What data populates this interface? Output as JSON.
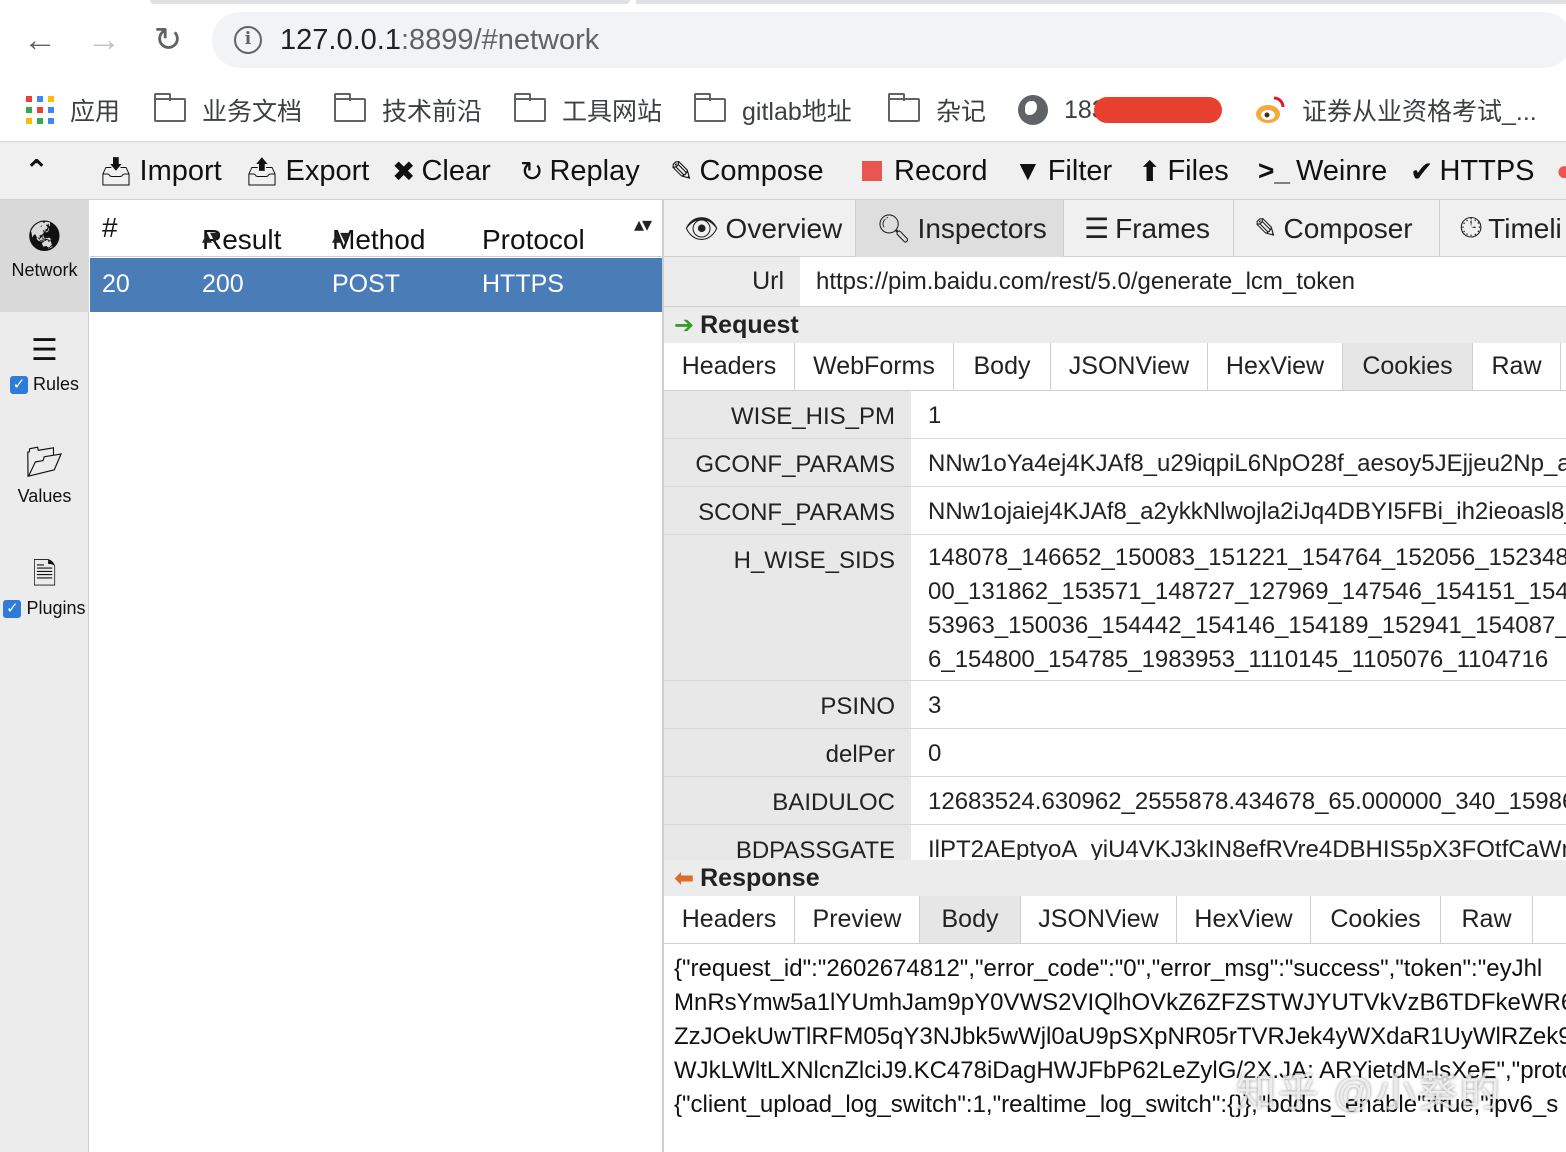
{
  "browser": {
    "nav": {
      "back": "←",
      "forward": "→",
      "reload": "↻"
    },
    "url_host": "127.0.0.1",
    "url_rest": ":8899/#network",
    "bookmarks": [
      {
        "label": "应用",
        "icon": "apps-icon"
      },
      {
        "label": "业务文档",
        "icon": "folder-icon"
      },
      {
        "label": "技术前沿",
        "icon": "folder-icon"
      },
      {
        "label": "工具网站",
        "icon": "folder-icon"
      },
      {
        "label": "gitlab地址",
        "icon": "folder-icon"
      },
      {
        "label": "杂记",
        "icon": "folder-icon"
      },
      {
        "label": "183",
        "icon": "globe-icon"
      },
      {
        "label": "证券从业资格考试_...",
        "icon": "weibo-icon"
      }
    ]
  },
  "toolbar": {
    "items": [
      {
        "label": "Import",
        "icon": "import-icon"
      },
      {
        "label": "Export",
        "icon": "export-icon"
      },
      {
        "label": "Clear",
        "icon": "clear-icon"
      },
      {
        "label": "Replay",
        "icon": "replay-icon"
      },
      {
        "label": "Compose",
        "icon": "compose-icon"
      },
      {
        "label": "Record",
        "icon": "record-icon"
      },
      {
        "label": "Filter",
        "icon": "filter-icon"
      },
      {
        "label": "Files",
        "icon": "files-icon"
      },
      {
        "label": "Weinre",
        "icon": "weinre-icon"
      },
      {
        "label": "HTTPS",
        "icon": "check-icon"
      }
    ]
  },
  "sidebar": {
    "items": [
      {
        "label": "Network",
        "icon": "globe-icon",
        "checked": null
      },
      {
        "label": "Rules",
        "icon": "list-icon",
        "checked": true
      },
      {
        "label": "Values",
        "icon": "folder-open-icon",
        "checked": null
      },
      {
        "label": "Plugins",
        "icon": "plugins-icon",
        "checked": true
      }
    ]
  },
  "sessions": {
    "columns": [
      "#",
      "Result",
      "Method",
      "Protocol"
    ],
    "rows": [
      {
        "id": "20",
        "result": "200",
        "method": "POST",
        "protocol": "HTTPS"
      }
    ]
  },
  "inspector": {
    "tabs": [
      {
        "label": "Overview",
        "icon": "eye-icon"
      },
      {
        "label": "Inspectors",
        "icon": "search-icon"
      },
      {
        "label": "Frames",
        "icon": "menu-icon"
      },
      {
        "label": "Composer",
        "icon": "compose-icon"
      },
      {
        "label": "Timeli",
        "icon": "clock-icon"
      }
    ],
    "active_tab": "Inspectors",
    "url_label": "Url",
    "url_value": "https://pim.baidu.com/rest/5.0/generate_lcm_token",
    "request": {
      "title": "Request",
      "tabs": [
        "Headers",
        "WebForms",
        "Body",
        "JSONView",
        "HexView",
        "Cookies",
        "Raw"
      ],
      "active_tab": "Cookies",
      "cookies": [
        {
          "name": "WISE_HIS_PM",
          "value": "1"
        },
        {
          "name": "GCONF_PARAMS",
          "value": "NNw1oYa4ej4KJAf8_u29iqpiL6NpO28f_aesoy5JEjjeu2Np_a"
        },
        {
          "name": "SCONF_PARAMS",
          "value": "NNw1ojaiej4KJAf8_a2ykkNlwojla2iJq4DBYI5FBi_ih2ieoasl8_"
        },
        {
          "name": "H_WISE_SIDS",
          "value": "148078_146652_150083_151221_154764_152056_152348_\n00_131862_153571_148727_127969_147546_154151_1542\n53963_150036_154442_154146_154189_152941_154087_1\n6_154800_154785_1983953_1110145_1105076_1104716"
        },
        {
          "name": "PSINO",
          "value": "3"
        },
        {
          "name": "delPer",
          "value": "0"
        },
        {
          "name": "BAIDULOC",
          "value": "12683524.630962_2555878.434678_65.000000_340_15986"
        },
        {
          "name": "BDPASSGATE",
          "value": "IlPT2AEptyoA_yiU4VKJ3kIN8efRVre4DBHIS5pX3FOtfCaWm"
        }
      ]
    },
    "response": {
      "title": "Response",
      "tabs": [
        "Headers",
        "Preview",
        "Body",
        "JSONView",
        "HexView",
        "Cookies",
        "Raw"
      ],
      "active_tab": "Body",
      "body": "{\"request_id\":\"2602674812\",\"error_code\":\"0\",\"error_msg\":\"success\",\"token\":\"eyJhl\nMnRsYmw5a1lYUmhJam9pY0VWS2VIQlhOVkZ6ZFZSTWJYUTVkVzB6TDFkeWR6N\nZzJOekUwTlRFM05qY3NJbk5wWjl0aU9pSXpNR05rTVRJek4yWXdaR1UyWlRZek9\nWJkLWltLXNlcnZlciJ9.KC478iDagHWJFbP62LeZylG/2X.JA: ARYietdM-lsXeE\",\"proto\n{\"client_upload_log_switch\":1,\"realtime_log_switch\":{}},\"bddns_enable\":true,\"ipv6_s"
    }
  },
  "watermark": "知乎 @小葵的"
}
